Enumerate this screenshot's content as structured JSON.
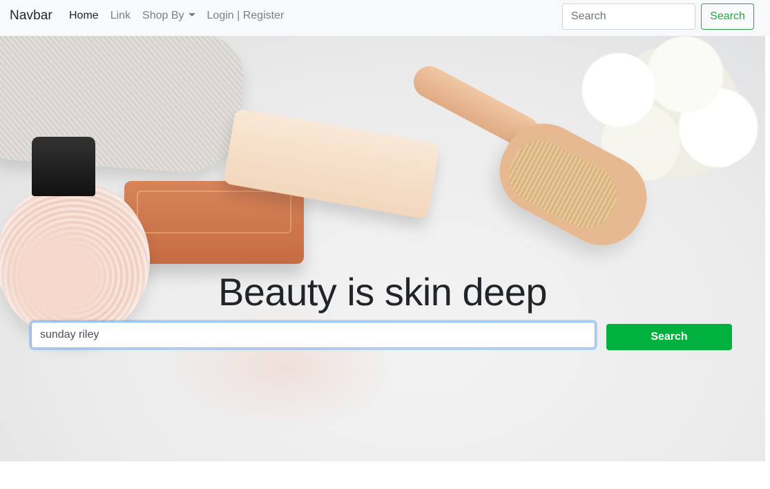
{
  "navbar": {
    "brand": "Navbar",
    "links": [
      {
        "label": "Home",
        "active": true
      },
      {
        "label": "Link",
        "active": false
      },
      {
        "label": "Shop By",
        "active": false,
        "dropdown": true
      },
      {
        "label": "Login | Register",
        "active": false
      }
    ],
    "search": {
      "placeholder": "Search",
      "value": "",
      "button_label": "Search"
    }
  },
  "hero": {
    "title": "Beauty is skin deep",
    "search": {
      "value": "sunday riley",
      "placeholder": "",
      "button_label": "Search"
    },
    "image_subject": "spa products: towel, soaps, bath salt bottle, brush, flower"
  },
  "colors": {
    "navbar_bg": "#f8f9fa",
    "success_outline": "#28a745",
    "primary_button": "#00b140",
    "focus_border": "#80bdff"
  }
}
